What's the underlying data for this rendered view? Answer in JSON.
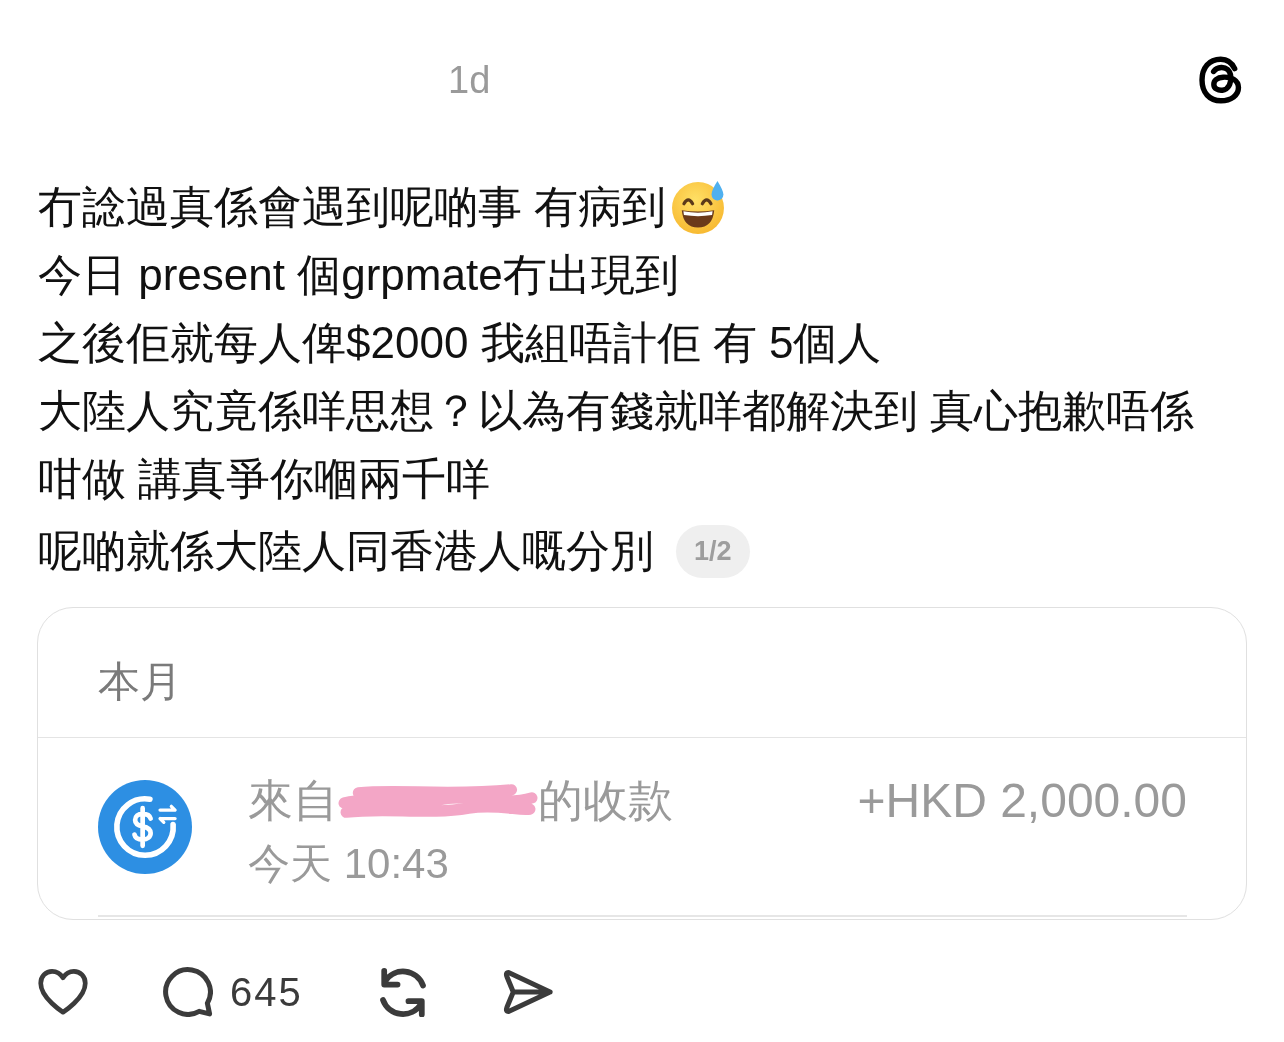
{
  "header": {
    "time": "1d"
  },
  "post": {
    "paragraphs": [
      {
        "text": "冇諗過真係會遇到呢啲事 有病到",
        "emoji": true
      },
      {
        "text": "今日 present 個grpmate冇出現到",
        "emoji": false
      },
      {
        "text": "之後佢就每人俾$2000 我組唔計佢 有 5個人",
        "emoji": false
      },
      {
        "text": "大陸人究竟係咩思想？以為有錢就咩都解決到 真心抱歉唔係咁做 講真爭你嗰兩千咩",
        "emoji": false
      },
      {
        "text": "呢啲就係大陸人同香港人嘅分別",
        "emoji": false
      }
    ],
    "page_indicator": "1/2"
  },
  "attachment": {
    "section_title": "本月",
    "transaction": {
      "title_prefix": "來自",
      "sender_redacted": true,
      "title_suffix": "的收款",
      "amount": "+HKD 2,000.00",
      "time": "今天 10:43"
    }
  },
  "actions": {
    "liked": false,
    "comments": "645"
  }
}
